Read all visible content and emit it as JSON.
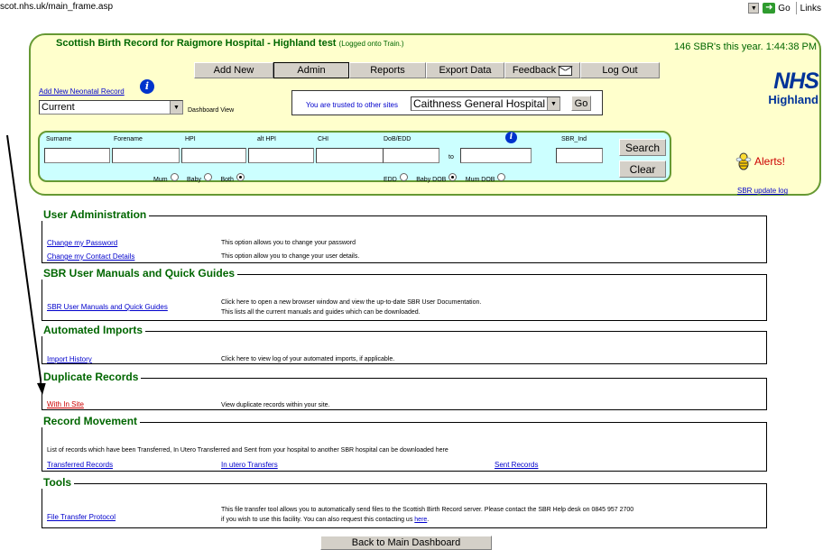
{
  "browser": {
    "url": "scot.nhs.uk/main_frame.asp",
    "go_label": "Go",
    "links_label": "Links"
  },
  "header": {
    "title": "Scottish Birth Record for Raigmore Hospital - Highland test",
    "login_status": "(Logged onto Train.)",
    "stats": "146 SBR's this year. 1:44:38 PM"
  },
  "nav": {
    "items": [
      {
        "label": "Add New"
      },
      {
        "label": "Admin"
      },
      {
        "label": "Reports"
      },
      {
        "label": "Export Data"
      },
      {
        "label": "Feedback"
      },
      {
        "label": "Log Out"
      }
    ]
  },
  "dashboard": {
    "add_neonatal_link": "Add New Neonatal Record",
    "view_select_value": "Current",
    "view_label": "Dashboard View",
    "trusted_label": "You are trusted to other sites",
    "trusted_site_value": "Caithness General Hospital",
    "go_button": "Go"
  },
  "logo": {
    "nhs": "NHS",
    "region": "Highland"
  },
  "search": {
    "labels": {
      "surname": "Surname",
      "forename": "Forename",
      "hpi": "HPI",
      "alt_hpi": "alt HPI",
      "chi": "CHI",
      "dob_edd": "DoB/EDD",
      "sbr_ind": "SBR_Ind",
      "to": "to"
    },
    "who_radios": [
      {
        "label": "Mum",
        "checked": false
      },
      {
        "label": "Baby",
        "checked": false
      },
      {
        "label": "Both",
        "checked": true
      }
    ],
    "date_radios": [
      {
        "label": "EDD",
        "checked": false
      },
      {
        "label": "Baby DOB",
        "checked": false
      },
      {
        "label": "Mum DOB",
        "checked": true
      },
      {
        "label": "",
        "checked": false
      }
    ],
    "search_button": "Search",
    "clear_button": "Clear"
  },
  "alerts": {
    "label": "Alerts!",
    "update_log_link": "SBR update log"
  },
  "sections": {
    "user_admin": {
      "title": "User Administration",
      "rows": [
        {
          "link": "Change my Password",
          "desc": "This option allows you to change your password"
        },
        {
          "link": "Change my Contact Details",
          "desc": "This option allow you to change your user details."
        }
      ]
    },
    "manuals": {
      "title": "SBR User Manuals and Quick Guides",
      "link": "SBR User Manuals and Quick Guides",
      "desc_line1": "Click here to open a new browser window and view the up-to-date SBR User Documentation.",
      "desc_line2": "This lists all the current manuals and guides which can be downloaded."
    },
    "imports": {
      "title": "Automated Imports",
      "link": "Import History",
      "desc": "Click here to view log of your automated imports, if applicable."
    },
    "duplicates": {
      "title": "Duplicate Records",
      "link": "With In Site",
      "desc": "View duplicate records within your site."
    },
    "movement": {
      "title": "Record Movement",
      "desc": "List of records which have been Transferred, In Utero Transferred and Sent from your hospital to another SBR hospital can be downloaded here",
      "links": [
        "Transferred Records",
        "In utero Transfers",
        "Sent Records"
      ]
    },
    "tools": {
      "title": "Tools",
      "link": "File Transfer Protocol",
      "desc_line1": "This file transfer tool allows you to automatically send files to the Scottish Birth Record server. Please contact the SBR Help desk on 0845 957 2700",
      "desc_line2_prefix": "if you wish to use this facility. You can also request this contacting us",
      "desc_here_link": "here",
      "desc_line2_suffix": "."
    }
  },
  "footer": {
    "back_button": "Back to Main Dashboard"
  },
  "colors": {
    "title_green": "#006600",
    "panel_yellow": "#ffffcc",
    "search_cyan": "#ccffff",
    "nhs_blue": "#003399",
    "alert_red": "#cc0000"
  }
}
